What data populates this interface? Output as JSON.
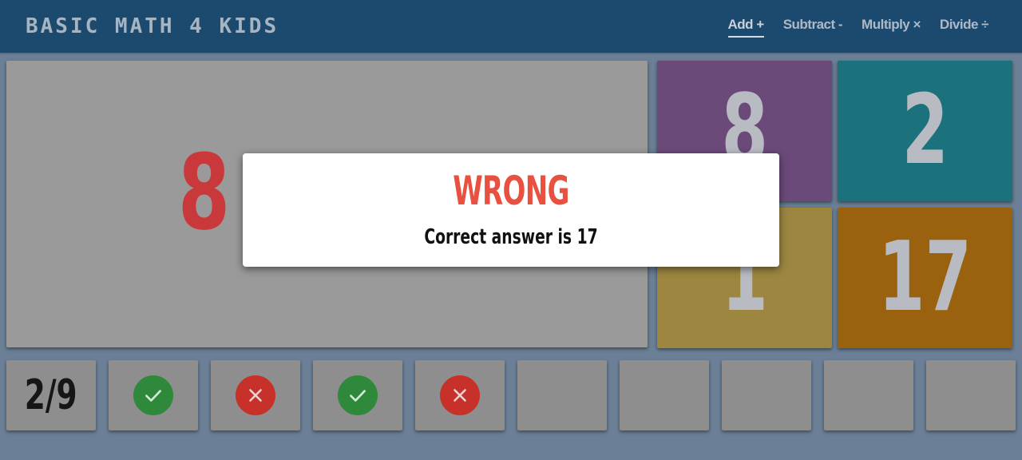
{
  "header": {
    "brand": "BASIC MATH 4 KIDS",
    "nav": [
      {
        "label": "Add +",
        "active": true
      },
      {
        "label": "Subtract -",
        "active": false
      },
      {
        "label": "Multiply ×",
        "active": false
      },
      {
        "label": "Divide ÷",
        "active": false
      }
    ]
  },
  "problem": {
    "operand": "8"
  },
  "choices": [
    {
      "value": "8",
      "color": "#6b4a7a"
    },
    {
      "value": "2",
      "color": "#1b717c"
    },
    {
      "value": "1",
      "color": "#9c8640"
    },
    {
      "value": "17",
      "color": "#9a620e"
    }
  ],
  "progress": {
    "score": "2/9",
    "results": [
      "right",
      "wrong",
      "right",
      "wrong",
      "",
      "",
      "",
      "",
      ""
    ]
  },
  "modal": {
    "title": "WRONG",
    "message": "Correct answer is 17"
  },
  "colors": {
    "header": "#1c4a6e",
    "background": "#6b7f96",
    "right": "#2e8a3a",
    "wrong": "#c8302a",
    "modal_title": "#e85040"
  }
}
